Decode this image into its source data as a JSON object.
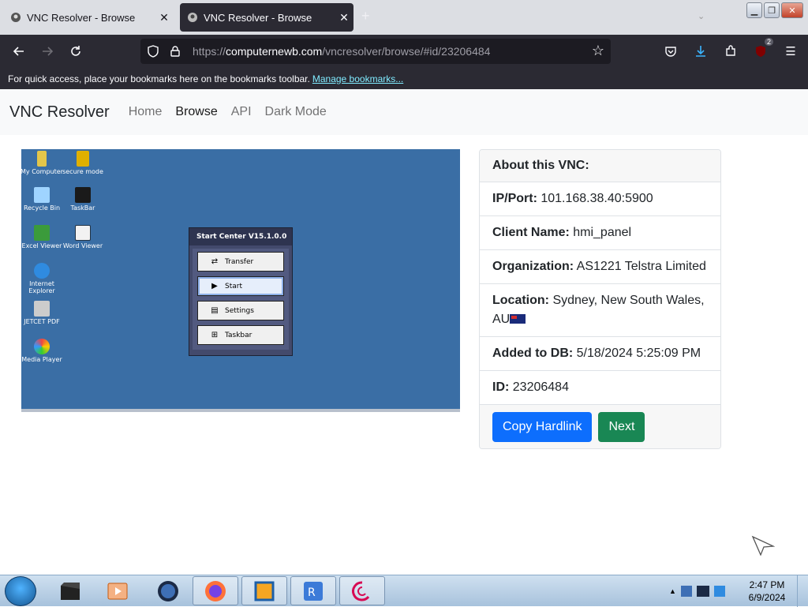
{
  "browser": {
    "tabs": [
      {
        "title": "VNC Resolver - Browse",
        "active": false
      },
      {
        "title": "VNC Resolver - Browse",
        "active": true
      }
    ],
    "url": {
      "prefix": "https://",
      "host": "computernewb.com",
      "path": "/vncresolver/browse/#id/23206484"
    },
    "extension_badge": "2",
    "bookmarks_text": "For quick access, place your bookmarks here on the bookmarks toolbar.",
    "bookmarks_link": "Manage bookmarks..."
  },
  "site": {
    "brand": "VNC Resolver",
    "nav": [
      "Home",
      "Browse",
      "API",
      "Dark Mode"
    ]
  },
  "screenshot": {
    "desktop_icons": [
      "My Computer",
      "secure mode",
      "Recycle Bin",
      "TaskBar",
      "Excel Viewer",
      "Word Viewer",
      "Internet Explorer",
      "JETCET PDF",
      "Media Player"
    ],
    "start_center": {
      "title": "Start Center V15.1.0.0",
      "buttons": [
        "Transfer",
        "Start",
        "Settings",
        "Taskbar"
      ]
    }
  },
  "card": {
    "header": "About this VNC:",
    "rows": [
      {
        "label": "IP/Port:",
        "value": "101.168.38.40:5900"
      },
      {
        "label": "Client Name:",
        "value": "hmi_panel"
      },
      {
        "label": "Organization:",
        "value": "AS1221 Telstra Limited"
      },
      {
        "label": "Location:",
        "value": "Sydney, New South Wales, AU"
      },
      {
        "label": "Added to DB:",
        "value": "5/18/2024 5:25:09 PM"
      },
      {
        "label": "ID:",
        "value": "23206484"
      }
    ],
    "buttons": {
      "copy": "Copy Hardlink",
      "next": "Next"
    }
  },
  "taskbar": {
    "time": "2:47 PM",
    "date": "6/9/2024"
  }
}
